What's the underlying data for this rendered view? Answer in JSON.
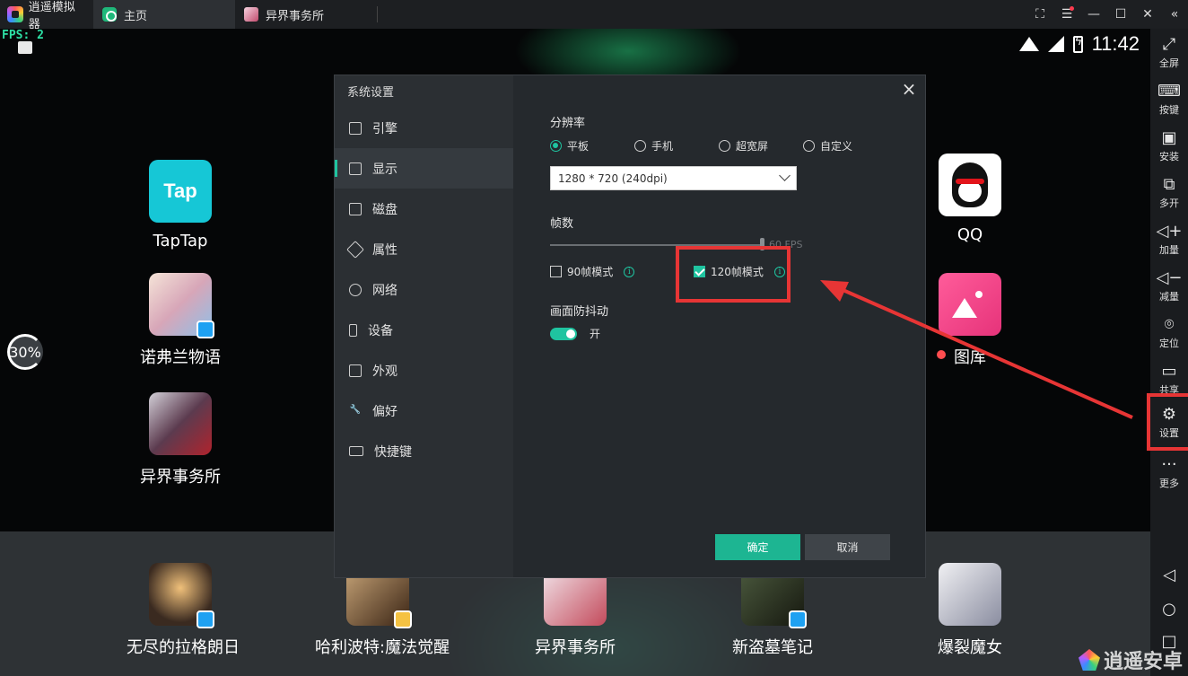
{
  "titlebar": {
    "app_name": "逍遥模拟器",
    "tabs": [
      {
        "label": "主页",
        "icon": "home-icon"
      },
      {
        "label": "异界事务所",
        "icon": "game-icon"
      }
    ],
    "controls": [
      "fullscreen-icon",
      "menu-icon",
      "minimize-icon",
      "maximize-icon",
      "close-icon",
      "collapse-icon"
    ]
  },
  "android": {
    "fps": "FPS: 2",
    "clock": "11:42",
    "perf_gauge": "30%",
    "desktop_apps_left": [
      {
        "label": "TapTap",
        "icon_text": "Tap"
      },
      {
        "label": "诺弗兰物语"
      },
      {
        "label": "异界事务所"
      }
    ],
    "desktop_apps_right": [
      {
        "label": "QQ"
      },
      {
        "label": "图库"
      }
    ],
    "dock_apps": [
      {
        "label": "无尽的拉格朗日"
      },
      {
        "label": "哈利波特:魔法觉醒"
      },
      {
        "label": "异界事务所"
      },
      {
        "label": "新盗墓笔记"
      },
      {
        "label": "爆裂魔女"
      }
    ]
  },
  "sidebar": {
    "items": [
      {
        "label": "全屏",
        "icon": "fullscreen-icon"
      },
      {
        "label": "按键",
        "icon": "keyboard-icon"
      },
      {
        "label": "安装",
        "icon": "apk-icon"
      },
      {
        "label": "多开",
        "icon": "multi-instance-icon"
      },
      {
        "label": "加量",
        "icon": "volume-up-icon"
      },
      {
        "label": "减量",
        "icon": "volume-down-icon"
      },
      {
        "label": "定位",
        "icon": "location-icon"
      },
      {
        "label": "共享",
        "icon": "folder-icon"
      },
      {
        "label": "设置",
        "icon": "gear-icon"
      },
      {
        "label": "更多",
        "icon": "more-icon"
      }
    ],
    "nav": [
      "back-icon",
      "home-circle-icon",
      "recents-icon"
    ]
  },
  "dialog": {
    "title": "系统设置",
    "nav": [
      {
        "label": "引擎",
        "icon": "chip-icon"
      },
      {
        "label": "显示",
        "icon": "monitor-icon"
      },
      {
        "label": "磁盘",
        "icon": "disk-icon"
      },
      {
        "label": "属性",
        "icon": "tag-icon"
      },
      {
        "label": "网络",
        "icon": "globe-icon"
      },
      {
        "label": "设备",
        "icon": "phone-icon"
      },
      {
        "label": "外观",
        "icon": "window-icon"
      },
      {
        "label": "偏好",
        "icon": "wrench-icon"
      },
      {
        "label": "快捷键",
        "icon": "keyboard-icon"
      }
    ],
    "active_nav": "显示",
    "resolution": {
      "title": "分辨率",
      "options": [
        "平板",
        "手机",
        "超宽屏",
        "自定义"
      ],
      "selected": "平板",
      "value": "1280 * 720 (240dpi)"
    },
    "fps": {
      "title": "帧数",
      "slider_value": "60 FPS",
      "mode_90": "90帧模式",
      "mode_120": "120帧模式",
      "mode_90_checked": false,
      "mode_120_checked": true
    },
    "stabilization": {
      "title": "画面防抖动",
      "toggle_label": "开",
      "enabled": true
    },
    "buttons": {
      "ok": "确定",
      "cancel": "取消"
    }
  },
  "watermark": "逍遥安卓",
  "colors": {
    "accent": "#1fc4a0",
    "highlight": "#e73535"
  }
}
